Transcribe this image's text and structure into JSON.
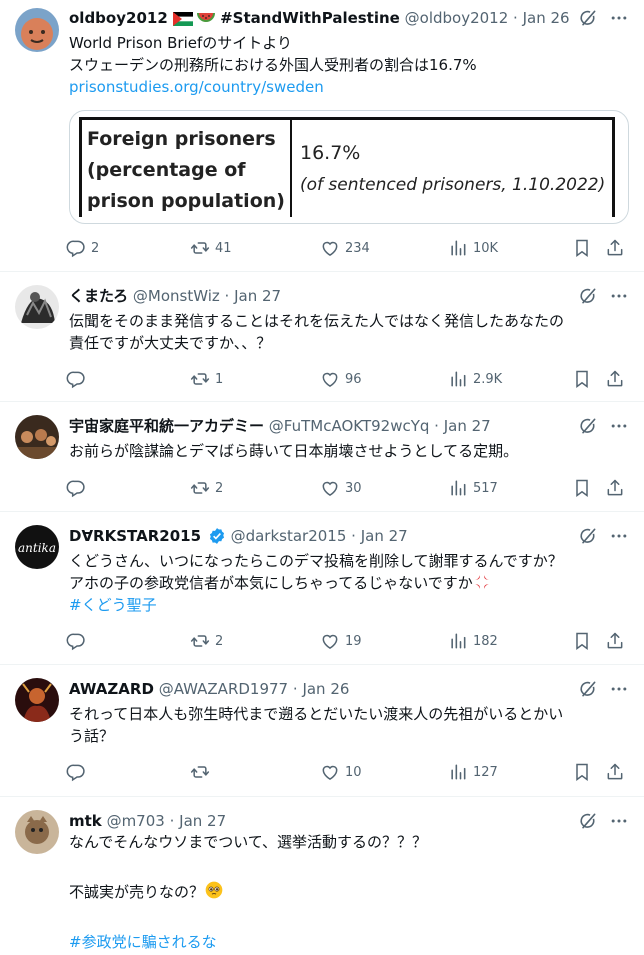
{
  "tweets": [
    {
      "name": "oldboy2012",
      "name_suffix": "#StandWithPalestine",
      "handle": "@oldboy2012",
      "date": "Jan 26",
      "lines": [
        "World Prison Briefのサイトより",
        "スウェーデンの刑務所における外国人受刑者の割合は16.7%"
      ],
      "link": "prisonstudies.org/country/sweden",
      "card": {
        "label_lines": [
          "Foreign prisoners",
          "(percentage of",
          "prison population)"
        ],
        "value": "16.7%",
        "sub": "(of sentenced prisoners, 1.10.2022)"
      },
      "replies": "2",
      "retweets": "41",
      "likes": "234",
      "views": "10K"
    },
    {
      "name": "くまたろ",
      "handle": "@MonstWiz",
      "date": "Jan 27",
      "lines": [
        "伝聞をそのまま発信することはそれを伝えた人ではなく発信したあなたの",
        "責任ですが大丈夫ですか、、？"
      ],
      "replies": "",
      "retweets": "1",
      "likes": "96",
      "views": "2.9K"
    },
    {
      "name": "宇宙家庭平和統一アカデミー",
      "handle": "@FuTMcAOKT92wcYq",
      "date": "Jan 27",
      "lines": [
        "お前らが陰謀論とデマばら蒔いて日本崩壊させようとしてる定期。"
      ],
      "replies": "",
      "retweets": "2",
      "likes": "30",
      "views": "517"
    },
    {
      "name": "D∀RKSTAR2015",
      "handle": "@darkstar2015",
      "date": "Jan 27",
      "lines": [
        "くどうさん、いつになったらこのデマ投稿を削除して謝罪するんですか？",
        "アホの子の参政党信者が本気にしちゃってるじゃないですか"
      ],
      "hashtag": "#くどう聖子",
      "avatar_text": "antika",
      "replies": "",
      "retweets": "2",
      "likes": "19",
      "views": "182"
    },
    {
      "name": "AWAZARD",
      "handle": "@AWAZARD1977",
      "date": "Jan 26",
      "lines": [
        "それって日本人も弥生時代まで遡るとだいたい渡来人の先祖がいるとかい",
        "う話？"
      ],
      "replies": "",
      "retweets": "",
      "likes": "10",
      "views": "127"
    },
    {
      "name": "mtk",
      "handle": "@m703",
      "date": "Jan 27",
      "lines": [
        "なんでそんなウソまでついて、選挙活動するの？？？",
        "",
        "不誠実が売りなの？"
      ],
      "hashtag": "#参政党に騙されるな"
    }
  ],
  "colors": {
    "text": "#0f1419",
    "secondary": "#536471",
    "accent": "#1d9bf0",
    "border": "#eff3f4"
  },
  "icons": [
    "reply-icon",
    "retweet-icon",
    "like-icon",
    "views-icon",
    "bookmark-icon",
    "share-icon",
    "grok-icon",
    "more-icon",
    "verified-badge-icon"
  ]
}
